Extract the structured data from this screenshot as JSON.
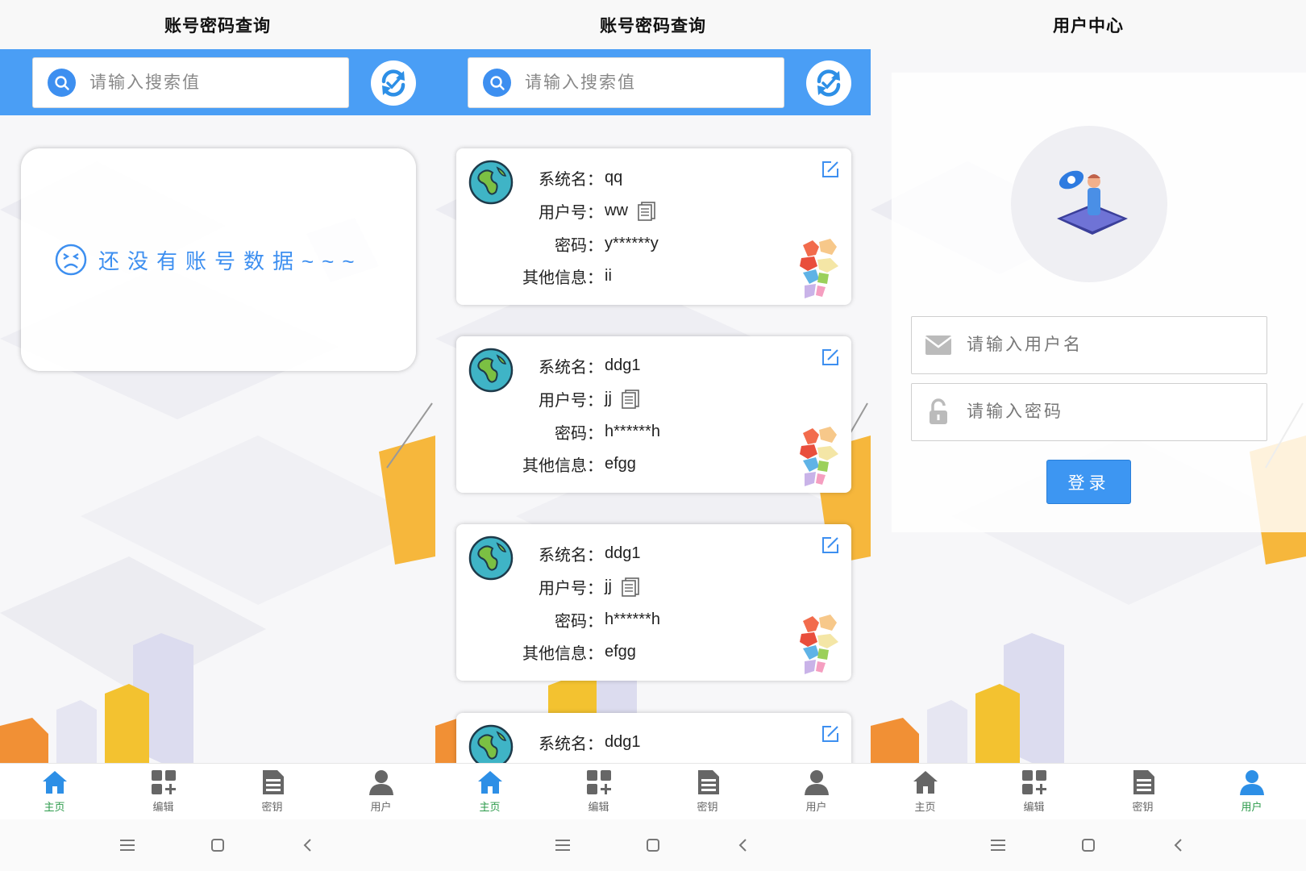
{
  "screens": [
    {
      "title": "账号密码查询",
      "search_placeholder": "请输入搜索值",
      "empty_text": "还没有账号数据~~~",
      "active_tab": "home"
    },
    {
      "title": "账号密码查询",
      "search_placeholder": "请输入搜索值",
      "active_tab": "home",
      "labels": {
        "system": "系统名：",
        "user": "用户号：",
        "password": "密码：",
        "other": "其他信息："
      },
      "accounts": [
        {
          "system": "qq",
          "user": "ww",
          "password": "y******y",
          "other": "ii"
        },
        {
          "system": "ddg1",
          "user": "jj",
          "password": "h******h",
          "other": "efgg"
        },
        {
          "system": "ddg1",
          "user": "jj",
          "password": "h******h",
          "other": "efgg"
        },
        {
          "system": "ddg1"
        }
      ]
    },
    {
      "title": "用户中心",
      "username_placeholder": "请输入用户名",
      "password_placeholder": "请输入密码",
      "login_label": "登录",
      "active_tab": "user"
    }
  ],
  "tabs": [
    {
      "label": "主页",
      "icon": "home-icon"
    },
    {
      "label": "编辑",
      "icon": "grid-add-icon"
    },
    {
      "label": "密钥",
      "icon": "document-icon"
    },
    {
      "label": "用户",
      "icon": "person-icon"
    }
  ],
  "colors": {
    "primary_blue": "#4a9ef5",
    "active_tab": "#2b9a4a",
    "inactive_icon": "#666666"
  },
  "system_nav": [
    "menu-icon",
    "square-icon",
    "back-icon"
  ]
}
